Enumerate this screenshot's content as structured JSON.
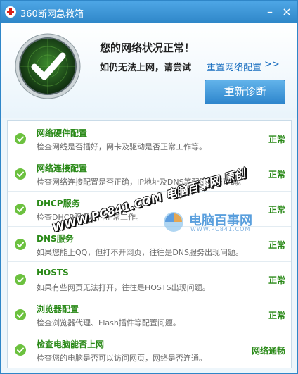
{
  "window": {
    "title": "360断网急救箱",
    "minimize_glyph": "–",
    "close_glyph": "×"
  },
  "header": {
    "status_title": "您的网络状况正常！",
    "status_hint": "如仍无法上网，请尝试",
    "reset_link": "重置网络配置",
    "reset_arrow": ">>",
    "rediagnose_button": "重新诊断"
  },
  "checks": [
    {
      "title": "网络硬件配置",
      "desc": "检查网线是否插好，网卡及驱动是否正常工作等。",
      "status": "正常",
      "icon": "check-circle-icon"
    },
    {
      "title": "网络连接配置",
      "desc": "检查网络连接配置是否正确，IP地址及DNS等配置是否正确。",
      "status": "正常",
      "icon": "check-circle-icon"
    },
    {
      "title": "DHCP服务",
      "desc": "检查DHCP服务是否正常工作。",
      "status": "正常",
      "icon": "check-circle-icon"
    },
    {
      "title": "DNS服务",
      "desc": "如果您能上QQ，但打不开网页，往往是DNS服务出现问题。",
      "status": "正常",
      "icon": "check-circle-icon"
    },
    {
      "title": "HOSTS",
      "desc": "如果有些网页无法打开，往往是HOSTS出现问题。",
      "status": "正常",
      "icon": "check-circle-icon"
    },
    {
      "title": "浏览器配置",
      "desc": "检查浏览器代理、Flash插件等配置问题。",
      "status": "正常",
      "icon": "check-circle-icon"
    },
    {
      "title": "检查电脑能否上网",
      "desc": "检查您的电脑是否可以访问网页，网络是否连通。",
      "status": "网络通畅",
      "icon": "check-circle-icon"
    }
  ],
  "watermark": {
    "overlay_text": "WWW.PC841.COM 电脑百事网 原创",
    "logo_text": "电脑百事网",
    "logo_sub": "WWW.PC841.COM"
  },
  "colors": {
    "title_bar": "#2f86c8",
    "ok_green": "#2b8a19",
    "link_blue": "#1a6fc0",
    "button_blue": "#2e86cd"
  }
}
